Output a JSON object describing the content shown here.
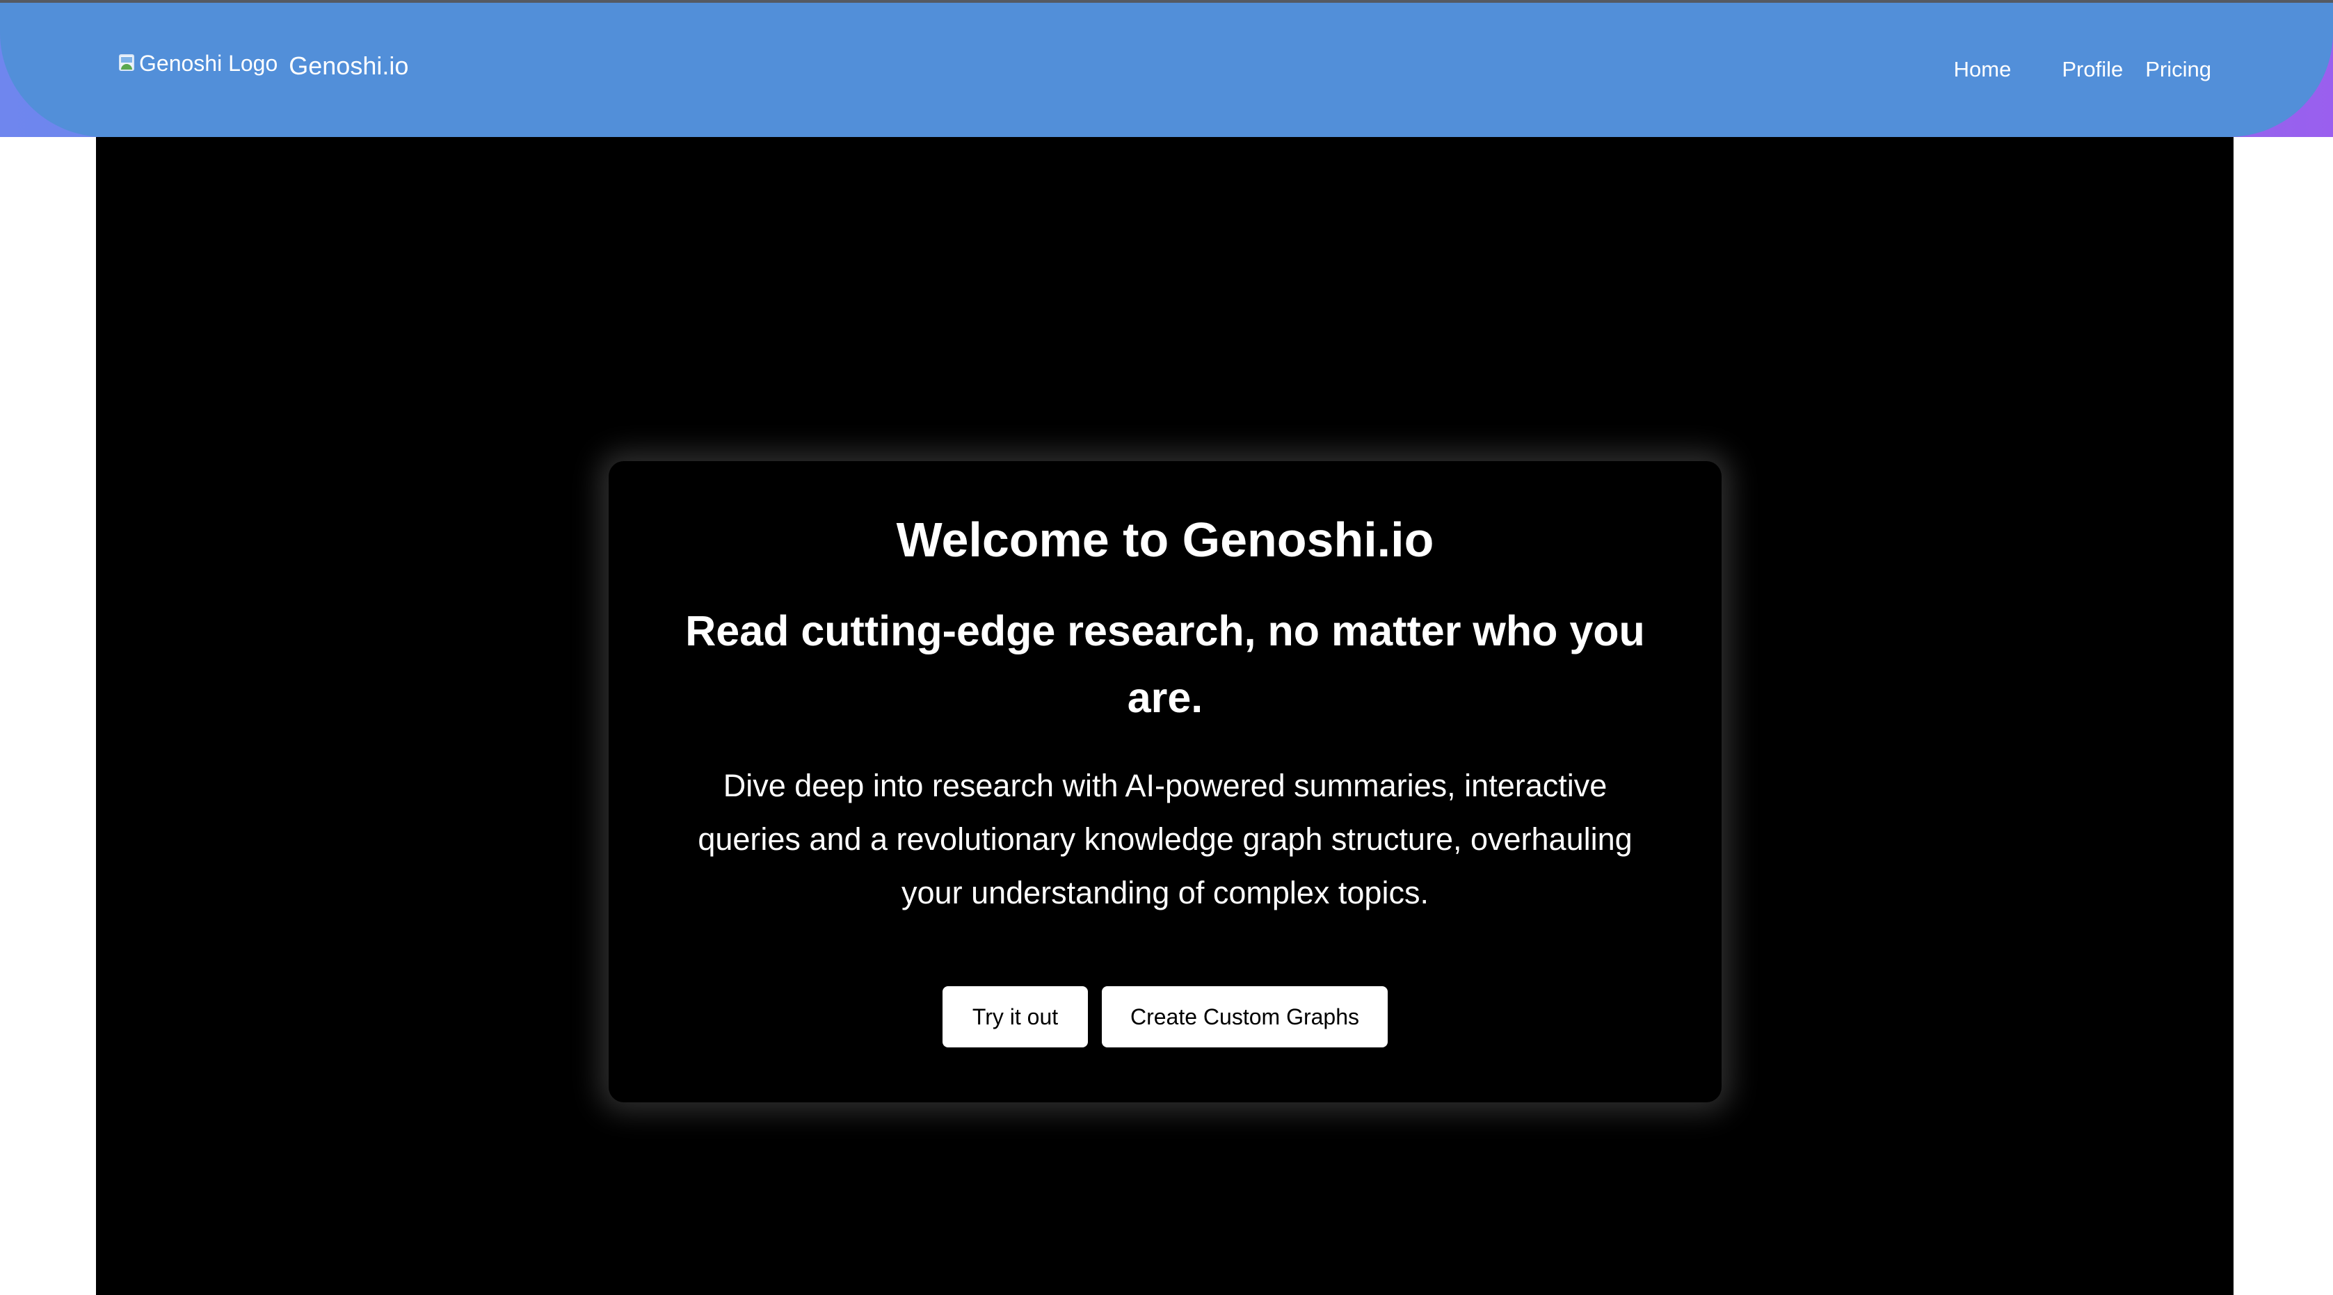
{
  "header": {
    "logo_alt": "Genoshi Logo",
    "brand": "Genoshi.io",
    "nav": {
      "home": "Home",
      "profile": "Profile",
      "pricing": "Pricing"
    }
  },
  "hero": {
    "title": "Welcome to Genoshi.io",
    "subtitle": "Read cutting-edge research, no matter who you are.",
    "description": "Dive deep into research with AI-powered summaries, interactive queries and a revolutionary knowledge graph structure, overhauling your understanding of complex topics.",
    "buttons": {
      "try": "Try it out",
      "graphs": "Create Custom Graphs"
    }
  },
  "colors": {
    "header": "#528fd9",
    "panel": "#000000",
    "button": "#ffffff"
  },
  "icons": {
    "logo": "broken-image-icon"
  }
}
